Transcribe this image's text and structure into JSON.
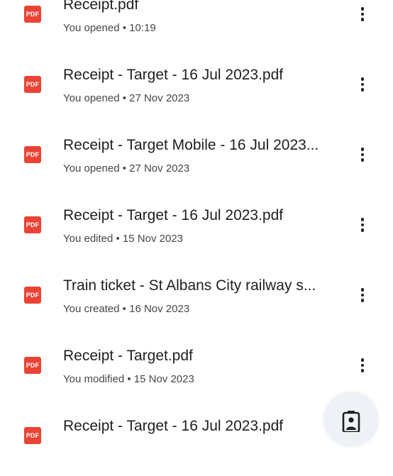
{
  "files": [
    {
      "icon": "pdf-icon",
      "icon_label": "PDF",
      "name": "Receipt.pdf",
      "activity": "You opened • 10:19"
    },
    {
      "icon": "pdf-icon",
      "icon_label": "PDF",
      "name": "Receipt - Target - 16 Jul 2023.pdf",
      "activity": "You opened • 27 Nov 2023"
    },
    {
      "icon": "pdf-icon",
      "icon_label": "PDF",
      "name": "Receipt - Target Mobile - 16 Jul 2023...",
      "activity": "You opened • 27 Nov 2023"
    },
    {
      "icon": "pdf-icon",
      "icon_label": "PDF",
      "name": "Receipt - Target - 16 Jul 2023.pdf",
      "activity": "You edited • 15 Nov 2023"
    },
    {
      "icon": "pdf-icon",
      "icon_label": "PDF",
      "name": "Train ticket - St Albans City railway s...",
      "activity": "You created • 16 Nov 2023"
    },
    {
      "icon": "pdf-icon",
      "icon_label": "PDF",
      "name": "Receipt - Target.pdf",
      "activity": "You modified • 15 Nov 2023"
    },
    {
      "icon": "pdf-icon",
      "icon_label": "PDF",
      "name": "Receipt - Target - 16 Jul 2023.pdf",
      "activity": ""
    }
  ],
  "more_icon": "more-vert-icon",
  "fab": {
    "icon": "scan-document-icon"
  },
  "colors": {
    "pdf_red": "#ea4335",
    "title_text": "#1f1f1f",
    "meta_text": "#444746",
    "fab_bg": "#eef1f5"
  }
}
